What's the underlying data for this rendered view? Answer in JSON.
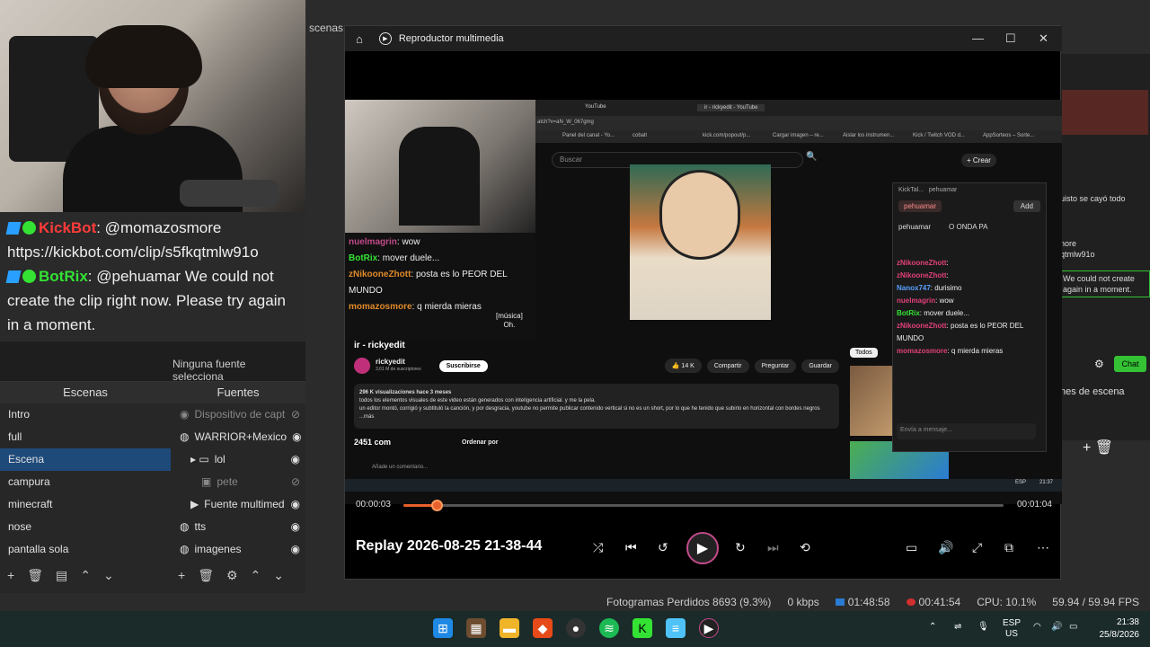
{
  "webcam_chat": {
    "line1_nick": "KickBot",
    "line1_text": ": @momazosmore",
    "line2_text": "https://kickbot.com/clip/s5fkqtmlw91o",
    "line3_nick": "BotRix",
    "line3_text": ": @pehuamar We could not create the clip right now. Please try again in a moment."
  },
  "obs": {
    "menu_partial": "scenas",
    "preview_label": "Ninguna fuente selecciona",
    "scenes_title": "Escenas",
    "scenes": [
      "Intro",
      "full",
      "Escena",
      "campura",
      "minecraft",
      "nose",
      "pantalla sola"
    ],
    "selected_scene": "Escena",
    "sources_title": "Fuentes",
    "sources": [
      {
        "label": "Dispositivo de capt",
        "icon": "camera-icon",
        "indent": 0,
        "dim": true
      },
      {
        "label": "WARRIOR+Mexico",
        "icon": "globe-icon",
        "indent": 0,
        "dim": false
      },
      {
        "label": "lol",
        "icon": "folder-icon",
        "indent": 1,
        "dim": false
      },
      {
        "label": "pete",
        "icon": "image-icon",
        "indent": 2,
        "dim": true
      },
      {
        "label": "Fuente multimed",
        "icon": "play-icon",
        "indent": 1,
        "dim": false
      },
      {
        "label": "tts",
        "icon": "globe-icon",
        "indent": 0,
        "dim": false
      },
      {
        "label": "imagenes",
        "icon": "globe-icon",
        "indent": 0,
        "dim": false
      }
    ],
    "side_fragment_1": "uisto se cayó todo",
    "side_fragment_2": "nore",
    "side_fragment_3": "qtmlw91o",
    "side_fragment_4": "We could not create again in a moment.",
    "side_scene_label": "nes de escena",
    "chat_button": "Chat"
  },
  "player": {
    "window_title": "Reproductor multimedia",
    "file_title": "Replay 2026-08-25 21-38-44",
    "current_time": "00:00:03",
    "total_time": "00:01:04",
    "progress": 0.055
  },
  "video_content": {
    "tab1": "YouTube",
    "tab2": "ir - rickyedit - YouTube",
    "url": "atch?v=aN_W_067gmg",
    "bookmarks": [
      "Panel del canal - Yo...",
      "cobalt",
      "kick.com/popout/p...",
      "Cargar imagen – re...",
      "Aislar los instrumen...",
      "Kick / Twitch VOD d...",
      "AppSorteos – Sorte..."
    ],
    "search_placeholder": "Buscar",
    "create_label": "+ Crear",
    "video_title": "ir - rickyedit",
    "channel": "rickyedit",
    "subscribers": "3,61 M de suscriptores",
    "subscribe": "Suscribirse",
    "likes": "14 K",
    "share": "Compartir",
    "ask": "Preguntar",
    "save": "Guardar",
    "views": "296 K visualizaciones  hace 3 meses",
    "desc1": "todos los elementos visuales de este video están generados con inteligencia artificial. y me la pela.",
    "desc2": "un editor montó, corrigió y subtituló la canción, y por desgracia, youtube no permite publicar contenido vertical si no es un short, por lo que he tenido que subirlo en horizontal con bordes negros  ...más",
    "comments": "2451 com",
    "sort": "Ordenar por",
    "add_comment": "Añade un comentario...",
    "music_caption": "[música]",
    "oh_caption": "Oh.",
    "chips": [
      "Todos"
    ],
    "vchat": [
      {
        "nick": "nuelmagrin",
        "text": ": wow"
      },
      {
        "nick": "BotRix",
        "text": ": mover duele..."
      },
      {
        "nick": "zNikooneZhott",
        "text": ": posta es lo PEOR DEL MUNDO"
      },
      {
        "nick": "momazosmore",
        "text": ": q mierda mieras"
      }
    ],
    "kick": {
      "header": "KickTal...",
      "user": "pehuamar",
      "add": "Add",
      "tab1": "pehuamar",
      "tab2": "O ONDA PA",
      "msgs": [
        {
          "nick": "zNikooneZhott",
          "text": ":"
        },
        {
          "nick": "zNikooneZhott",
          "text": ":"
        },
        {
          "nick": "Nanox747",
          "text": ": durisimo"
        },
        {
          "nick": "nuelmagrin",
          "text": ": wow"
        },
        {
          "nick": "BotRix",
          "text": ": mover duele..."
        },
        {
          "nick": "zNikooneZhott",
          "text": ": posta es lo PEOR DEL MUNDO"
        },
        {
          "nick": "momazosmore",
          "text": ": q mierda mieras"
        }
      ],
      "input_placeholder": "Envía a mensaje..."
    },
    "mini_clock": "21:37",
    "mini_lang": "ESP"
  },
  "status": {
    "dropped": "Fotogramas Perdidos 8693 (9.3%)",
    "kbps": "0 kbps",
    "rec_time": "01:48:58",
    "live_time": "00:41:54",
    "cpu": "CPU: 10.1%",
    "fps": "59.94 / 59.94 FPS"
  },
  "taskbar": {
    "lang": "ESP",
    "layout": "US",
    "time": "21:38",
    "date": "25/8/2026"
  },
  "colors": {
    "accent_orange": "#e8602c",
    "kick_green": "#34e234",
    "kick_red": "#ff3b3b",
    "obs_selected": "#1e4a7a"
  }
}
